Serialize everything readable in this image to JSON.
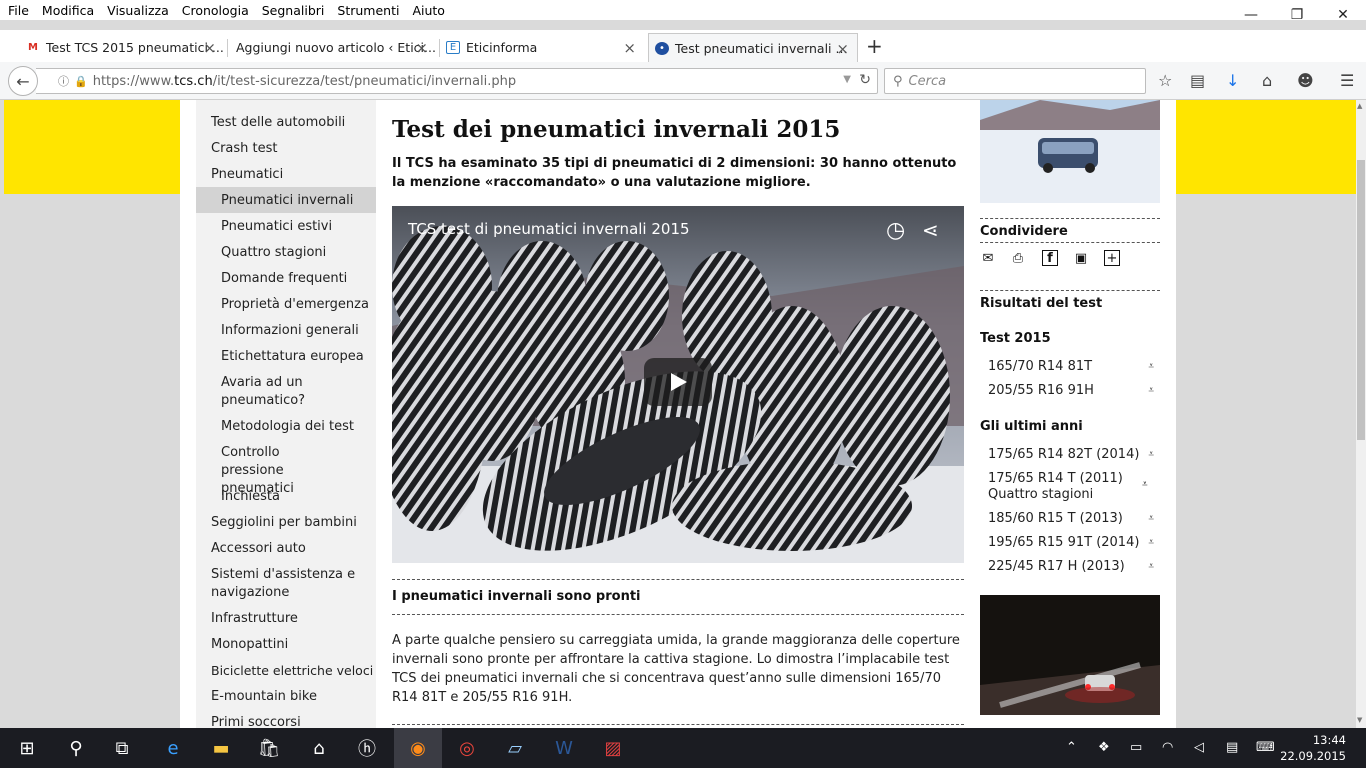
{
  "menubar": {
    "items": [
      "File",
      "Modifica",
      "Visualizza",
      "Cronologia",
      "Segnalibri",
      "Strumenti",
      "Aiuto"
    ]
  },
  "window_controls": {
    "minimize": "—",
    "restore": "❐",
    "close": "✕"
  },
  "tabs": [
    {
      "label": "Test TCS 2015 pneumatici ...",
      "favicon": "gmail-icon"
    },
    {
      "label": "Aggiungi nuovo articolo ‹ Etici...",
      "favicon": "wordpress-icon"
    },
    {
      "label": "Eticinforma",
      "favicon": "eticinforma-icon"
    },
    {
      "label": "Test pneumatici invernali ...",
      "favicon": "tcs-icon",
      "active": true
    }
  ],
  "navbar": {
    "url_prefix": "https://www.",
    "url_domain": "tcs.ch",
    "url_path": "/it/test-sicurezza/test/pneumatici/invernali.php",
    "search_placeholder": "Cerca"
  },
  "leftnav": {
    "items": [
      {
        "label": "Test delle automobili",
        "level": 1
      },
      {
        "label": "Crash test",
        "level": 1
      },
      {
        "label": "Pneumatici",
        "level": 1
      },
      {
        "label": "Pneumatici invernali",
        "level": 2,
        "selected": true
      },
      {
        "label": "Pneumatici estivi",
        "level": 2
      },
      {
        "label": "Quattro stagioni",
        "level": 2
      },
      {
        "label": "Domande frequenti",
        "level": 2
      },
      {
        "label": "Proprietà d'emergenza",
        "level": 2
      },
      {
        "label": "Informazioni generali",
        "level": 2
      },
      {
        "label": "Etichettatura europea",
        "level": 2
      },
      {
        "label": "Avaria ad un pneumatico?",
        "level": 2
      },
      {
        "label": "Metodologia dei test",
        "level": 2
      },
      {
        "label": "Controllo pressione pneumatici",
        "level": 2
      },
      {
        "label": "Inchiesta",
        "level": 2
      },
      {
        "label": "Seggiolini per bambini",
        "level": 1
      },
      {
        "label": "Accessori auto",
        "level": 1
      },
      {
        "label": "Sistemi d'assistenza e navigazione",
        "level": 1
      },
      {
        "label": "Infrastrutture",
        "level": 1
      },
      {
        "label": "Monopattini",
        "level": 1
      },
      {
        "label": "Biciclette elettriche veloci",
        "level": 1
      },
      {
        "label": "E-mountain bike",
        "level": 1
      },
      {
        "label": "Primi soccorsi",
        "level": 1
      }
    ]
  },
  "main": {
    "title": "Test dei pneumatici invernali 2015",
    "lead": "Il TCS ha esaminato 35 tipi di pneumatici di 2 dimensioni: 30 hanno ottenuto la menzione «raccomandato» o una valutazione migliore.",
    "video_title": "TCS test di pneumatici invernali 2015",
    "section_title": "I pneumatici invernali sono pronti",
    "body": "A parte qualche pensiero su carreggiata umida, la grande maggioranza delle coperture invernali sono pronte per affrontare la cattiva stagione. Lo dimostra l’implacabile test TCS dei pneumatici invernali che si concentrava quest’anno sulle dimensioni 165/70 R14 81T e 205/55 R16 91H."
  },
  "right": {
    "share_heading": "Condividere",
    "results_heading": "Risultati del test",
    "test2015_heading": "Test 2015",
    "test2015_items": [
      "165/70 R14 81T",
      "205/55 R16 91H"
    ],
    "last_years_heading": "Gli ultimi anni",
    "last_years_items": [
      "175/65 R14 82T (2014)",
      "175/65 R14 T (2011) Quattro stagioni",
      "185/60 R15 T (2013)",
      "195/65 R15 91T (2014)",
      "225/45 R17 H (2013)"
    ]
  },
  "taskbar": {
    "time": "13:44",
    "date": "22.09.2015"
  },
  "colors": {
    "accent_yellow": "#ffe500",
    "nav_bg": "#f2f2f2",
    "nav_selected": "#d3d3d3",
    "taskbar": "#1b1c22"
  }
}
